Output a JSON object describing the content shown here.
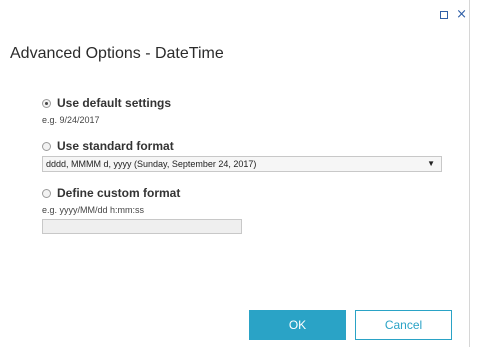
{
  "window": {
    "maximize_icon": "maximize-icon",
    "close_icon": "close-icon",
    "close_glyph": "×"
  },
  "title": "Advanced Options - DateTime",
  "options": {
    "default": {
      "label": "Use default settings",
      "example": "e.g. 9/24/2017",
      "selected": true
    },
    "standard": {
      "label": "Use standard format",
      "selected": false,
      "format_value": "dddd, MMMM d, yyyy (Sunday, September 24, 2017)",
      "dropdown_arrow": "▼"
    },
    "custom": {
      "label": "Define custom format",
      "example": "e.g. yyyy/MM/dd h:mm:ss",
      "selected": false,
      "input_value": ""
    }
  },
  "buttons": {
    "ok": "OK",
    "cancel": "Cancel"
  },
  "colors": {
    "accent": "#2aa3c6",
    "window_controls": "#2f5fa7"
  }
}
